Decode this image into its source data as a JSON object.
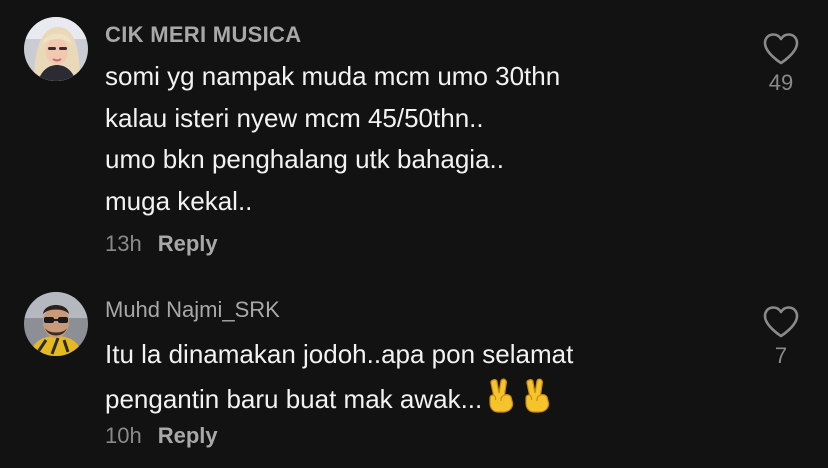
{
  "comments": [
    {
      "username": "CIK MERI MUSICA",
      "text_lines": [
        "somi yg nampak muda mcm umo 30thn",
        "kalau isteri nyew mcm 45/50thn..",
        "umo bkn penghalang utk bahagia..",
        "muga kekal.."
      ],
      "time": "13h",
      "reply_label": "Reply",
      "like_count": "49"
    },
    {
      "username": "Muhd Najmi_SRK",
      "text_lines": [
        "Itu la dinamakan jodoh..apa pon selamat",
        "pengantin baru buat mak awak..."
      ],
      "emoji": [
        "victory-hand-emoji",
        "victory-hand-emoji"
      ],
      "time": "10h",
      "reply_label": "Reply",
      "like_count": "7"
    }
  ],
  "colors": {
    "background": "#121212",
    "username": "#a8a8a8",
    "text": "#f2f2f2",
    "meta": "#8a8a8a"
  },
  "icons": {
    "like": "heart-outline-icon"
  }
}
